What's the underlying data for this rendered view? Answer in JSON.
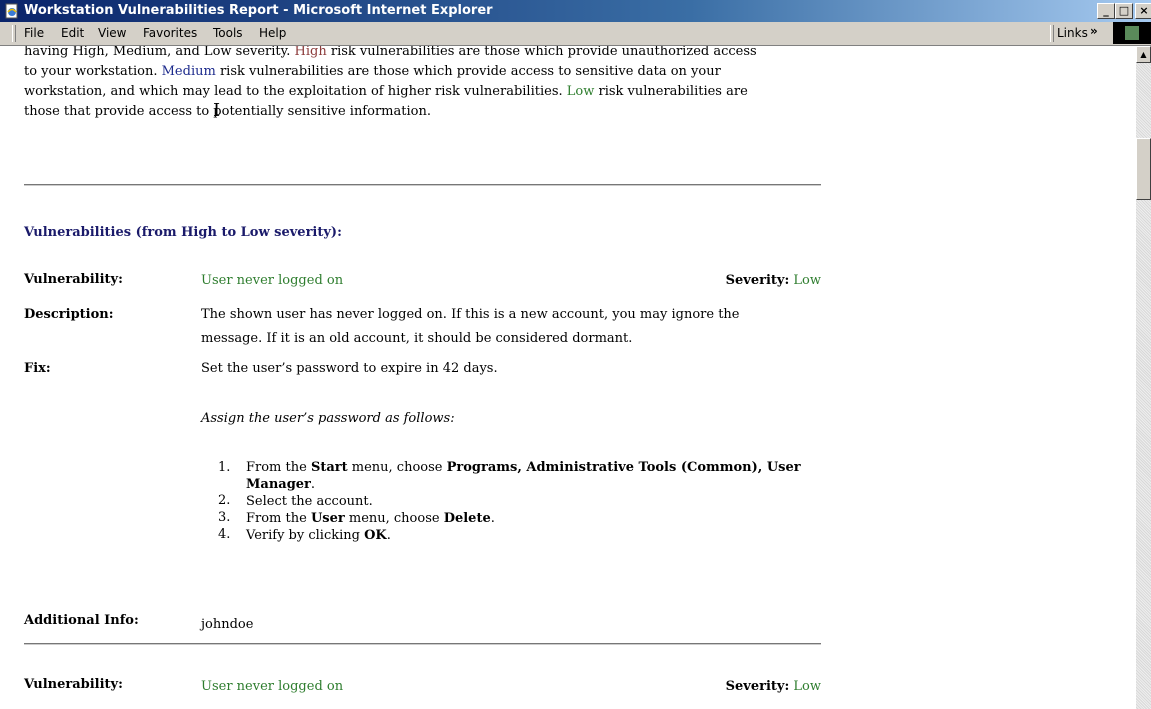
{
  "window": {
    "title": "Workstation Vulnerabilities Report - Microsoft Internet Explorer"
  },
  "menu": {
    "items": [
      "File",
      "Edit",
      "View",
      "Favorites",
      "Tools",
      "Help"
    ],
    "links_label": "Links",
    "links_chevron": "»"
  },
  "intro": {
    "line1": "having High, Medium, and Low severity.",
    "line1_high": "High",
    "line1_rest": " risk vulnerabilities are those which provide unauthorized access",
    "line2_a": "to your workstation. ",
    "line2_medium": "Medium",
    "line2_b": " risk vulnerabilities are those which provide access to sensitive data on your",
    "line3_a": "workstation, and which may lead to the exploitation of higher risk vulnerabilities. ",
    "line3_low": "Low",
    "line3_b": " risk vulnerabilities are",
    "line4": "those that provide access to potentially sensitive information."
  },
  "section_heading": "Vulnerabilities (from High to Low severity):",
  "labels": {
    "vulnerability": "Vulnerability:",
    "description": "Description:",
    "fix": "Fix:",
    "additional_info": "Additional Info:",
    "severity": "Severity:"
  },
  "vuln1": {
    "name": "User never logged on",
    "severity": "Low",
    "description_line1": "The shown user has never logged on. If this is a new account, you may ignore the",
    "description_line2": "message. If it is an old account, it should be considered dormant.",
    "fix": "Set the user’s password to expire in 42 days.",
    "fix_subhead": "Assign the user’s password as follows:",
    "steps": {
      "s1_a": "From the ",
      "s1_start": "Start",
      "s1_b": " menu, choose ",
      "s1_programs": "Programs, Administrative Tools (Common), User",
      "s1_manager": "Manager",
      "s1_end": ".",
      "s2": "Select the account.",
      "s3_a": "From the ",
      "s3_user": "User",
      "s3_b": " menu, choose ",
      "s3_delete": "Delete",
      "s3_end": ".",
      "s4_a": "Verify by clicking ",
      "s4_ok": "OK",
      "s4_end": "."
    },
    "step_numbers": [
      "1.",
      "2.",
      "3.",
      "4."
    ],
    "additional_info": "johndoe"
  },
  "vuln2": {
    "name": "User never logged on",
    "severity": "Low"
  },
  "colors": {
    "high": "#8b3a3a",
    "medium": "#1c2a8c",
    "low": "#2e7d2e",
    "heading": "#1a1a6a",
    "titlebar": "#0a246a"
  },
  "icons": {
    "app": "ie-page-icon",
    "minimize": "minimize-icon",
    "maximize": "maximize-icon",
    "close": "close-icon"
  }
}
